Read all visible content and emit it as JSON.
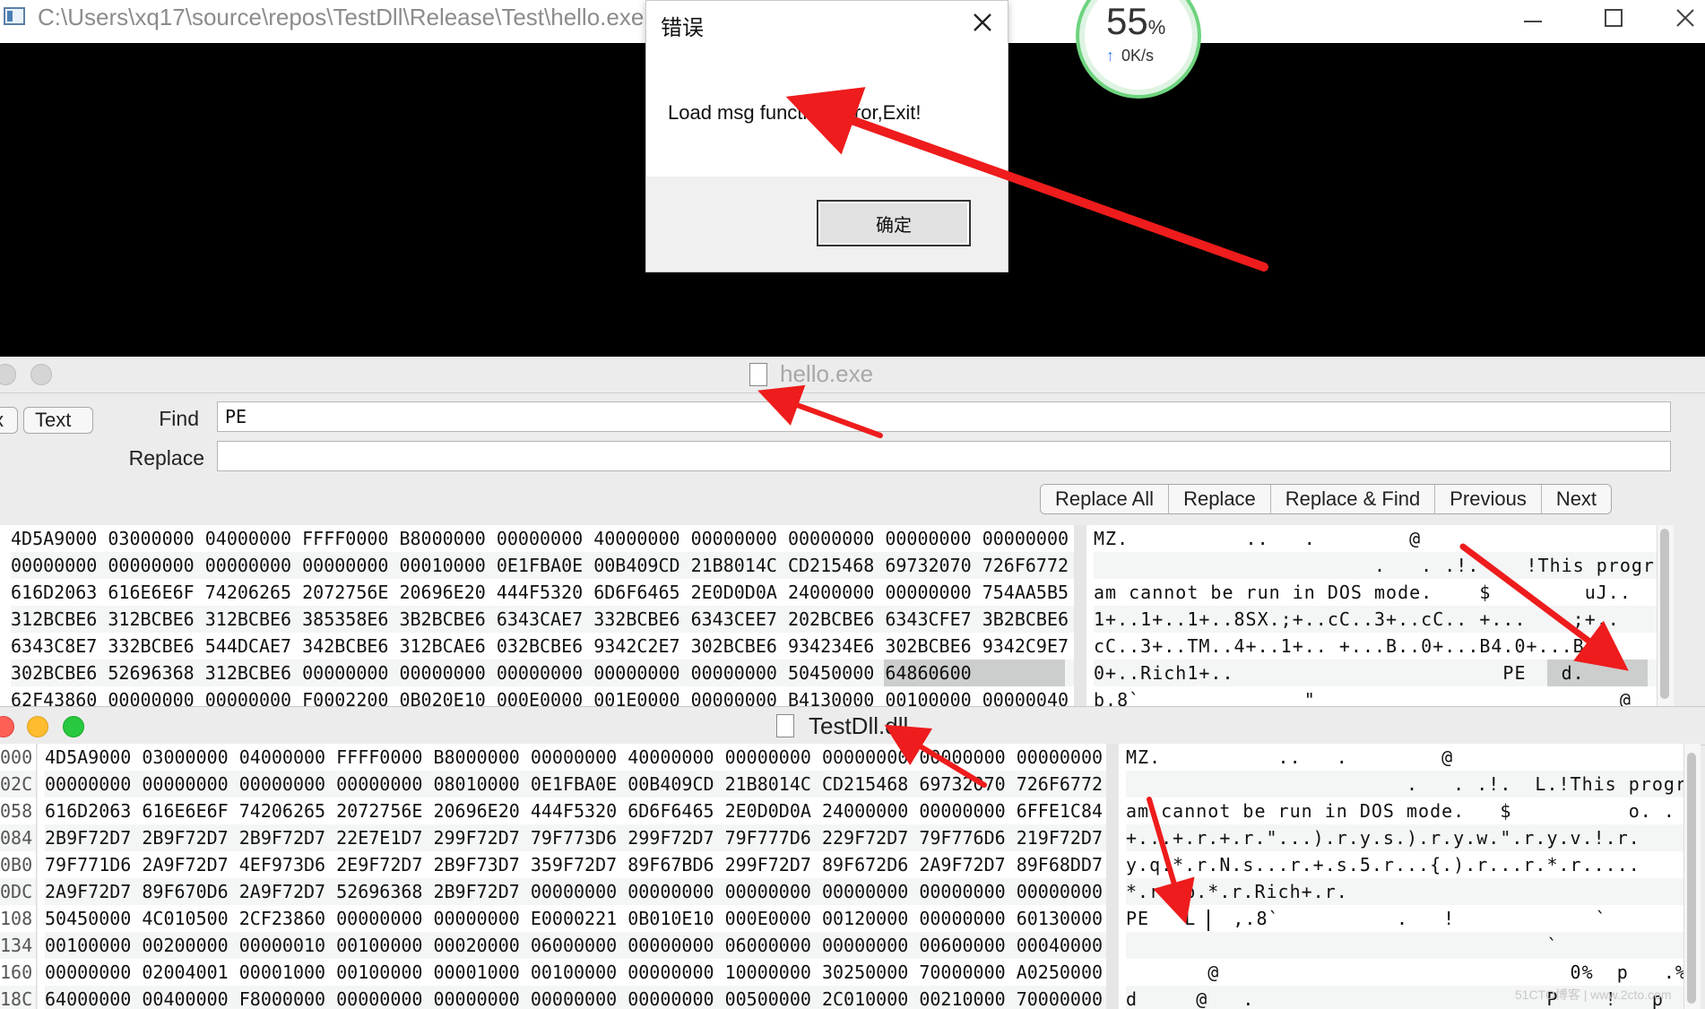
{
  "console": {
    "title": "C:\\Users\\xq17\\source\\repos\\TestDll\\Release\\Test\\hello.exe"
  },
  "speed_widget": {
    "percent": "55",
    "percent_sign": "%",
    "rate": "0K/s"
  },
  "dialog": {
    "title": "错误",
    "message": "Load msg function Error,Exit!",
    "ok_label": "确定"
  },
  "hello_window": {
    "title": "hello.exe",
    "mode_buttons": [
      "x",
      "Text"
    ],
    "find_label": "Find",
    "find_value": "PE",
    "replace_label": "Replace",
    "replace_value": "",
    "buttons": [
      "Replace All",
      "Replace",
      "Replace & Find",
      "Previous",
      "Next"
    ],
    "hex_rows": [
      "4D5A9000 03000000 04000000 FFFF0000 B8000000 00000000 40000000 00000000 00000000 00000000 00000000",
      "00000000 00000000 00000000 00000000 00010000 0E1FBA0E 00B409CD 21B8014C CD215468 69732070 726F6772",
      "616D2063 616E6E6F 74206265 2072756E 20696E20 444F5320 6D6F6465 2E0D0D0A 24000000 00000000 754AA5B5",
      "312BCBE6 312BCBE6 312BCBE6 385358E6 3B2BCBE6 6343CAE7 332BCBE6 6343CEE7 202BCBE6 6343CFE7 3B2BCBE6",
      "6343C8E7 332BCBE6 544DCAE7 342BCBE6 312BCAE6 032BCBE6 9342C2E7 302BCBE6 934234E6 302BCBE6 9342C9E7",
      "302BCBE6 52696368 312BCBE6 00000000 00000000 00000000 00000000 00000000 50450000 64860600",
      "62F43860 00000000 00000000 F0002200 0B020E10 000E0000 001E0000 00000000 B4130000 00100000 00000040"
    ],
    "ascii_rows": [
      "MZ.          ..   .        @",
      "                        .   . .!.    !This progr",
      "am cannot be run in DOS mode.    $        uJ..",
      "1+..1+..1+..8SX.;+..cC..3+..cC.. +...   .;+..",
      "cC..3+..TM..4+..1+.. +...B..0+...B4.0+...B..",
      "0+..Rich1+..                       PE   d.",
      "b.8`              \"                          @"
    ]
  },
  "testdll_window": {
    "title": "TestDll.dll",
    "offsets": [
      "000",
      "02C",
      "058",
      "084",
      "0B0",
      "0DC",
      "108",
      "134",
      "160",
      "18C"
    ],
    "hex_rows": [
      "4D5A9000 03000000 04000000 FFFF0000 B8000000 00000000 40000000 00000000 00000000 00000000 00000000",
      "00000000 00000000 00000000 00000000 08010000 0E1FBA0E 00B409CD 21B8014C CD215468 69732070 726F6772",
      "616D2063 616E6E6F 74206265 2072756E 20696E20 444F5320 6D6F6465 2E0D0D0A 24000000 00000000 6FFE1C84",
      "2B9F72D7 2B9F72D7 2B9F72D7 22E7E1D7 299F72D7 79F773D6 299F72D7 79F777D6 229F72D7 79F776D6 219F72D7",
      "79F771D6 2A9F72D7 4EF973D6 2E9F72D7 2B9F73D7 359F72D7 89F67BD6 299F72D7 89F672D6 2A9F72D7 89F68DD7",
      "2A9F72D7 89F670D6 2A9F72D7 52696368 2B9F72D7 00000000 00000000 00000000 00000000 00000000 00000000",
      "50450000 4C010500 2CF23860 00000000 00000000 E0000221 0B010E10 000E0000 00120000 00000000 60130000",
      "00100000 00200000 00000010 00100000 00020000 06000000 00000000 06000000 00000000 00600000 00040000",
      "00000000 02004001 00001000 00100000 00001000 00100000 00000000 10000000 30250000 70000000 A0250000",
      "64000000 00400000 F8000000 00000000 00000000 00000000 00000000 00500000 2C010000 00210000 70000000"
    ],
    "ascii_rows": [
      "MZ.          ..   .        @",
      "                        .   . .!.  L.!This progr",
      "am cannot be run in DOS mode.   $          o. .",
      "+...+.r.+.r.\"...).r.y.s.).r.y.w.\".r.y.v.!.r.",
      "y.q.*.r.N.s...r.+.s.5.r...{.).r...r.*.r.....",
      "*.r..p.*.r.Rich+.r.",
      "PE   L ",
      "                                    `",
      "       @                              0%  p   .%",
      "d     @   .                         P    !   p"
    ],
    "cursor_after": "PE   L ",
    "cursor_tail": "  ,.8`          .   !            `"
  },
  "watermark": "51CTO博客 | www.2cto.com"
}
